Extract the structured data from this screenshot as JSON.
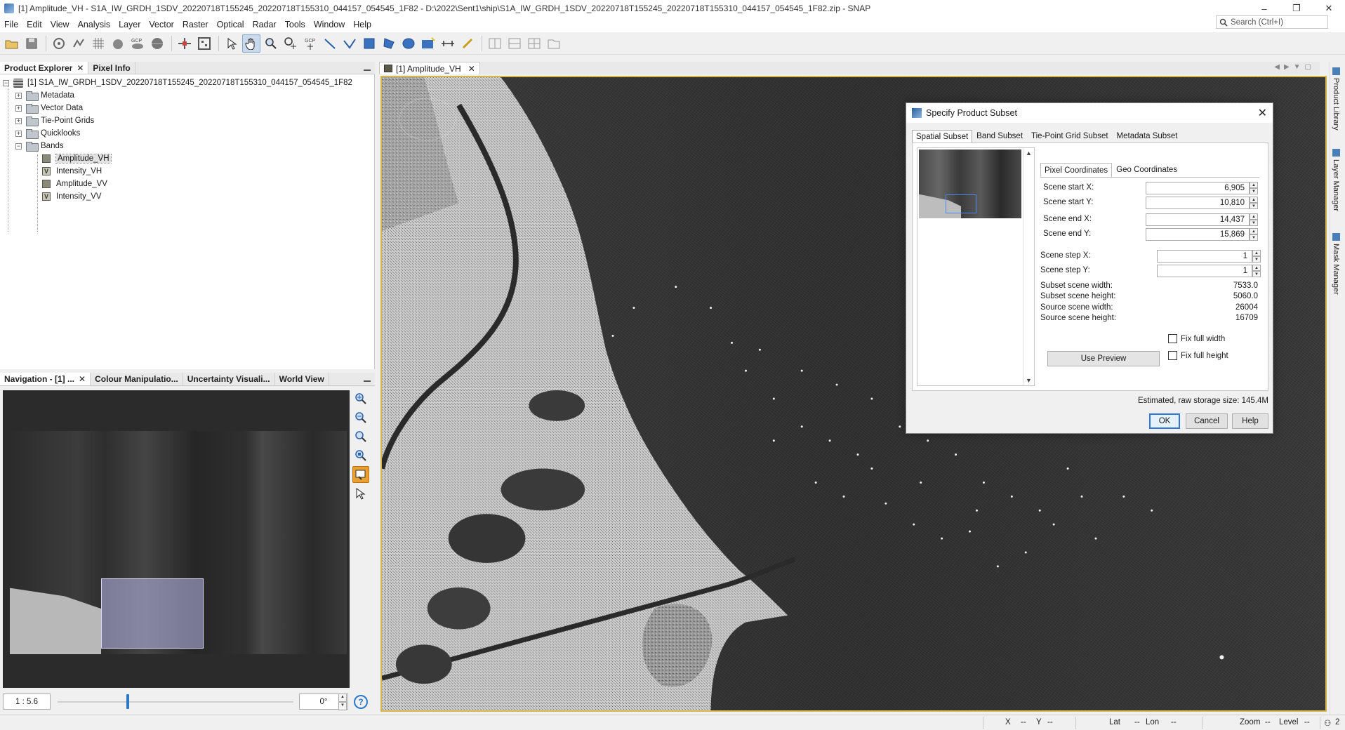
{
  "window": {
    "title": "[1] Amplitude_VH - S1A_IW_GRDH_1SDV_20220718T155245_20220718T155310_044157_054545_1F82 - D:\\2022\\Sent1\\ship\\S1A_IW_GRDH_1SDV_20220718T155245_20220718T155310_044157_054545_1F82.zip - SNAP",
    "controls": [
      "–",
      "❐",
      "✕"
    ]
  },
  "menu": [
    "File",
    "Edit",
    "View",
    "Analysis",
    "Layer",
    "Vector",
    "Raster",
    "Optical",
    "Radar",
    "Tools",
    "Window",
    "Help"
  ],
  "search": {
    "placeholder": "Search (Ctrl+I)"
  },
  "toolbar": {
    "gcp_label": "GCP"
  },
  "product_explorer": {
    "tabs": [
      "Product Explorer",
      "Pixel Info"
    ],
    "product": "[1] S1A_IW_GRDH_1SDV_20220718T155245_20220718T155310_044157_054545_1F82",
    "nodes": [
      "Metadata",
      "Vector Data",
      "Tie-Point Grids",
      "Quicklooks",
      "Bands"
    ],
    "bands": [
      "Amplitude_VH",
      "Intensity_VH",
      "Amplitude_VV",
      "Intensity_VV"
    ],
    "virtual_mark": "V"
  },
  "navigation": {
    "tabs": [
      "Navigation - [1] ...",
      "Colour Manipulatio...",
      "Uncertainty Visuali...",
      "World View"
    ],
    "scale": "1 : 5.6",
    "rotation": "0°",
    "help": "?"
  },
  "image_view": {
    "tab": "[1] Amplitude_VH"
  },
  "side_tabs": [
    "Product Library",
    "Layer Manager",
    "Mask Manager"
  ],
  "statusbar": {
    "x_label": "X",
    "x_val": "--",
    "y_label": "Y",
    "y_val": "--",
    "lat_label": "Lat",
    "lat_val": "--",
    "lon_label": "Lon",
    "lon_val": "--",
    "zoom_label": "Zoom",
    "zoom_val": "--",
    "level_label": "Level",
    "level_val": "--",
    "badge": "2"
  },
  "dialog": {
    "title": "Specify Product Subset",
    "tabs": [
      "Spatial Subset",
      "Band Subset",
      "Tie-Point Grid Subset",
      "Metadata Subset"
    ],
    "coord_tabs": [
      "Pixel Coordinates",
      "Geo Coordinates"
    ],
    "fields": [
      {
        "label": "Scene start X:",
        "value": "6,905"
      },
      {
        "label": "Scene start Y:",
        "value": "10,810"
      },
      {
        "label": "Scene end X:",
        "value": "14,437"
      },
      {
        "label": "Scene end Y:",
        "value": "15,869"
      }
    ],
    "steps": [
      {
        "label": "Scene step X:",
        "value": "1"
      },
      {
        "label": "Scene step Y:",
        "value": "1"
      }
    ],
    "info": [
      {
        "label": "Subset scene width:",
        "value": "7533.0"
      },
      {
        "label": "Subset scene height:",
        "value": "5060.0"
      },
      {
        "label": "Source scene width:",
        "value": "26004"
      },
      {
        "label": "Source scene height:",
        "value": "16709"
      }
    ],
    "use_preview": "Use Preview",
    "fix_full_width": "Fix full width",
    "fix_full_height": "Fix full height",
    "estimated": "Estimated, raw storage size: 145.4M",
    "ok": "OK",
    "cancel": "Cancel",
    "help": "Help"
  }
}
